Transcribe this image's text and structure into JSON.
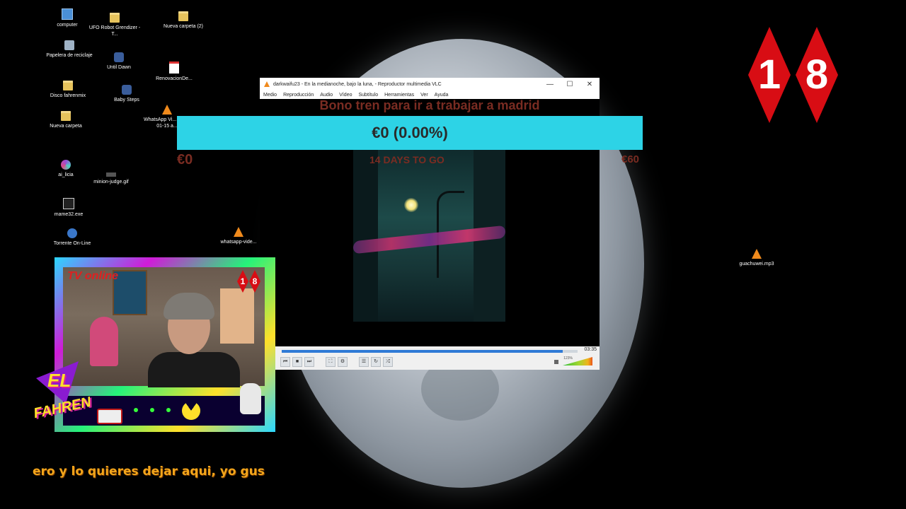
{
  "desktop": {
    "icons": [
      {
        "label": "computer",
        "icon": "computer-icon"
      },
      {
        "label": "UFO Robot Grendizer - T...",
        "icon": "folder-icon"
      },
      {
        "label": "Nueva carpeta (2)",
        "icon": "folder-icon"
      },
      {
        "label": "Papelera de reciclaje",
        "icon": "recycle-bin-icon"
      },
      {
        "label": "Until Dawn",
        "icon": "game-icon"
      },
      {
        "label": "RenovacionDe...",
        "icon": "pdf-icon"
      },
      {
        "label": "Disco fahrenmix",
        "icon": "folder-icon"
      },
      {
        "label": "Baby Steps",
        "icon": "game-icon"
      },
      {
        "label": "WhatsApp Vi... 2026-01-15 a...",
        "icon": "vlc-file-icon"
      },
      {
        "label": "Nueva carpeta",
        "icon": "folder-icon"
      },
      {
        "label": "ai_licia",
        "icon": "app-icon"
      },
      {
        "label": "minion-judge.gif",
        "icon": "gif-icon"
      },
      {
        "label": "mame32.exe",
        "icon": "exe-icon"
      },
      {
        "label": "Torrente On-Line",
        "icon": "torrent-icon"
      },
      {
        "label": "whatsapp-vide...",
        "icon": "vlc-file-icon"
      },
      {
        "label": "guachuwei.mp3",
        "icon": "vlc-file-icon"
      }
    ]
  },
  "vlc": {
    "title": "darkwaifu23 - En la medianoche, bajo la luna, - Reproductor multimedia VLC",
    "window_buttons": {
      "minimize": "—",
      "maximize": "☐",
      "close": "✕"
    },
    "menu": [
      "Medio",
      "Reproducción",
      "Audio",
      "Vídeo",
      "Subtítulo",
      "Herramientas",
      "Ver",
      "Ayuda"
    ],
    "time": "03:35",
    "seek_fraction": 0.95,
    "volume_percent": "123%",
    "control_buttons": [
      "⏮",
      "■",
      "⏭",
      "⛶",
      "⚙",
      "☰",
      "↻",
      "⤮"
    ]
  },
  "overlay": {
    "title": "Bono tren para ir a trabajar a madrid",
    "progress_text": "€0 (0.00%)",
    "progress_fraction": 0.0,
    "min_label": "€0",
    "max_label": "€60",
    "days_left": "14 DAYS TO GO"
  },
  "age_badge": [
    "1",
    "8"
  ],
  "webcam": {
    "brand": "TV online",
    "mini_badge": [
      "1",
      "8"
    ],
    "logo_line1": "EL",
    "logo_line2": "FAHREN"
  },
  "ticker": "ero y lo quieres dejar aqui, yo gus",
  "colors": {
    "progress_bar": "#2dd3e6",
    "overlay_text": "#7a2c22",
    "badge_red": "#d80d14",
    "ticker": "#f2a51b"
  }
}
